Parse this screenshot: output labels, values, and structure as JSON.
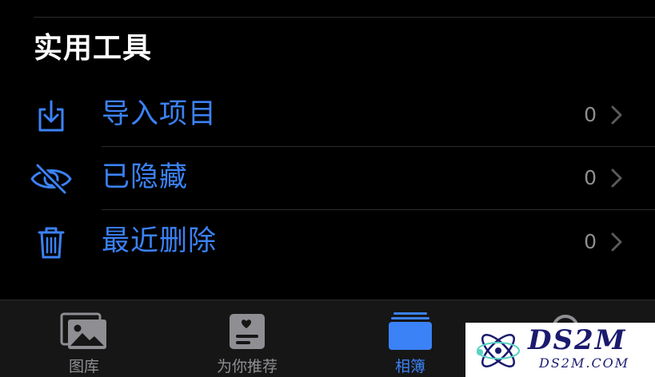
{
  "section": {
    "title": "实用工具"
  },
  "rows": [
    {
      "label": "导入项目",
      "count": "0",
      "icon": "import-icon"
    },
    {
      "label": "已隐藏",
      "count": "0",
      "icon": "eye-slash-icon"
    },
    {
      "label": "最近删除",
      "count": "0",
      "icon": "trash-icon"
    }
  ],
  "tabs": [
    {
      "label": "图库",
      "icon": "photos-icon",
      "active": false
    },
    {
      "label": "为你推荐",
      "icon": "for-you-icon",
      "active": false
    },
    {
      "label": "相簿",
      "icon": "albums-icon",
      "active": true
    }
  ],
  "watermark": {
    "text": "DS2M",
    "subtext": "DS2M.COM"
  },
  "colors": {
    "accent": "#3b82f6",
    "background": "#000000",
    "tabbar": "#161616",
    "secondary_text": "#8e8e93"
  }
}
